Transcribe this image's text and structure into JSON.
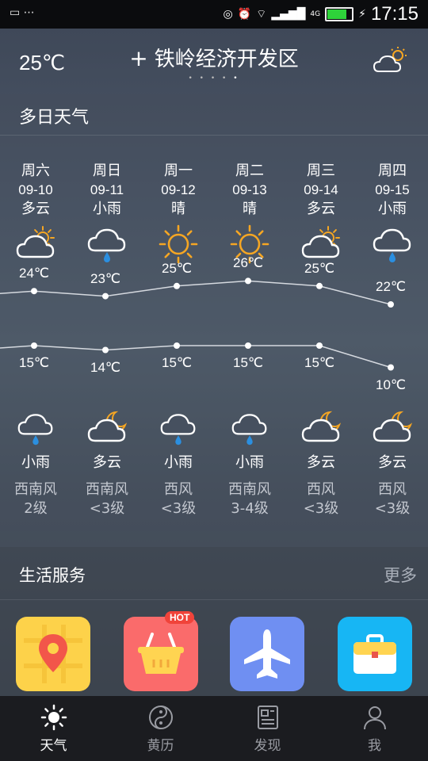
{
  "status_bar": {
    "time": "17:15",
    "network_label": "4G"
  },
  "header": {
    "current_temp": "25℃",
    "add_symbol": "+",
    "city": "铁岭经济开发区",
    "page_dots": "• • • •",
    "active_dot": "•"
  },
  "forecast": {
    "title": "多日天气",
    "days": [
      {
        "weekday": "周六",
        "date": "09-10",
        "day_weather": "多云",
        "day_icon": "partly-cloudy-sun-icon",
        "high": "24℃",
        "low": "15℃",
        "night_icon": "rain-icon",
        "night_weather": "小雨",
        "wind_dir": "西南风",
        "wind_level": "2级"
      },
      {
        "weekday": "周日",
        "date": "09-11",
        "day_weather": "小雨",
        "day_icon": "rain-icon",
        "high": "23℃",
        "low": "14℃",
        "night_icon": "partly-cloudy-moon-icon",
        "night_weather": "多云",
        "wind_dir": "西南风",
        "wind_level": "<3级"
      },
      {
        "weekday": "周一",
        "date": "09-12",
        "day_weather": "晴",
        "day_icon": "sun-icon",
        "high": "25℃",
        "low": "15℃",
        "night_icon": "rain-icon",
        "night_weather": "小雨",
        "wind_dir": "西风",
        "wind_level": "<3级"
      },
      {
        "weekday": "周二",
        "date": "09-13",
        "day_weather": "晴",
        "day_icon": "sun-icon",
        "high": "26℃",
        "low": "15℃",
        "night_icon": "rain-icon",
        "night_weather": "小雨",
        "wind_dir": "西南风",
        "wind_level": "3-4级"
      },
      {
        "weekday": "周三",
        "date": "09-14",
        "day_weather": "多云",
        "day_icon": "partly-cloudy-sun-icon",
        "high": "25℃",
        "low": "15℃",
        "night_icon": "partly-cloudy-moon-icon",
        "night_weather": "多云",
        "wind_dir": "西风",
        "wind_level": "<3级"
      },
      {
        "weekday": "周四",
        "date": "09-15",
        "day_weather": "小雨",
        "day_icon": "rain-icon",
        "high": "22℃",
        "low": "10℃",
        "night_icon": "partly-cloudy-moon-icon",
        "night_weather": "多云",
        "wind_dir": "西风",
        "wind_level": "<3级"
      }
    ],
    "highs": [
      24,
      23,
      25,
      26,
      25,
      22
    ],
    "lows": [
      15,
      14,
      15,
      15,
      15,
      10
    ]
  },
  "services": {
    "title": "生活服务",
    "more": "更多",
    "hot_badge": "HOT",
    "apps": [
      {
        "icon": "map-pin-icon",
        "color": "#fdd24a"
      },
      {
        "icon": "shopping-basket-icon",
        "color": "#fa6b6b"
      },
      {
        "icon": "airplane-icon",
        "color": "#6f8ff2"
      },
      {
        "icon": "briefcase-icon",
        "color": "#17b6f4"
      }
    ]
  },
  "tabbar": {
    "tabs": [
      {
        "label": "天气",
        "icon": "sun-icon",
        "active": true
      },
      {
        "label": "黄历",
        "icon": "yin-yang-icon",
        "active": false
      },
      {
        "label": "发现",
        "icon": "news-icon",
        "active": false
      },
      {
        "label": "我",
        "icon": "person-icon",
        "active": false
      }
    ]
  },
  "colors": {
    "sun": "#f5a623",
    "rain_drop": "#2b8fe0",
    "tab_active": "#ffffff",
    "tab_inactive": "#9a9ca3"
  }
}
